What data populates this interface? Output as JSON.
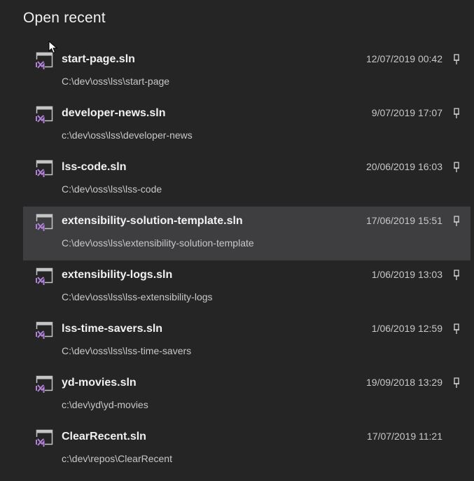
{
  "header": {
    "title": "Open recent"
  },
  "recent": {
    "items": [
      {
        "name": "start-page.sln",
        "path": "C:\\dev\\oss\\lss\\start-page",
        "date": "12/07/2019 00:42",
        "pinned": true
      },
      {
        "name": "developer-news.sln",
        "path": "c:\\dev\\oss\\lss\\developer-news",
        "date": "9/07/2019 17:07",
        "pinned": true
      },
      {
        "name": "lss-code.sln",
        "path": "C:\\dev\\oss\\lss\\lss-code",
        "date": "20/06/2019 16:03",
        "pinned": true
      },
      {
        "name": "extensibility-solution-template.sln",
        "path": "C:\\dev\\oss\\lss\\extensibility-solution-template",
        "date": "17/06/2019 15:51",
        "pinned": true,
        "selected": true
      },
      {
        "name": "extensibility-logs.sln",
        "path": "C:\\dev\\oss\\lss\\lss-extensibility-logs",
        "date": "1/06/2019 13:03",
        "pinned": true
      },
      {
        "name": "lss-time-savers.sln",
        "path": "C:\\dev\\oss\\lss\\lss-time-savers",
        "date": "1/06/2019 12:59",
        "pinned": true
      },
      {
        "name": "yd-movies.sln",
        "path": "c:\\dev\\yd\\yd-movies",
        "date": "19/09/2018 13:29",
        "pinned": true
      },
      {
        "name": "ClearRecent.sln",
        "path": "c:\\dev\\repos\\ClearRecent",
        "date": "17/07/2019 11:21",
        "pinned": false
      }
    ]
  },
  "colors": {
    "background": "#252526",
    "selected_row": "#3e3e40",
    "vs_purple": "#b180d7",
    "text_primary": "#f1f1f1",
    "text_secondary": "#c8c8c8"
  },
  "icons": {
    "solution": "visual-studio-solution-icon",
    "pin": "pin-icon",
    "cursor": "mouse-cursor-icon"
  }
}
